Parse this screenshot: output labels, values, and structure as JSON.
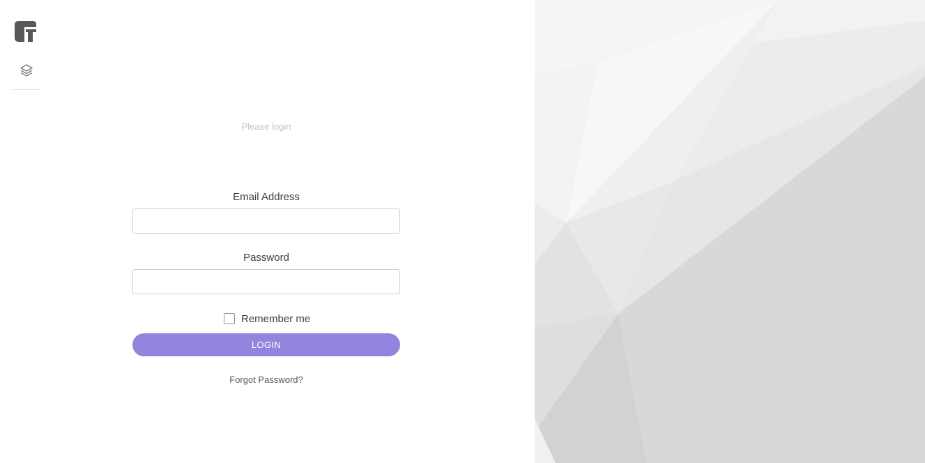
{
  "rail": {
    "logo_icon": "brand-logo-icon",
    "nav_icon": "layers-icon"
  },
  "login": {
    "subtitle": "Please login",
    "email_label": "Email Address",
    "email_value": "",
    "password_label": "Password",
    "password_value": "",
    "remember_label": "Remember me",
    "remember_checked": false,
    "button_label": "LOGIN",
    "forgot_label": "Forgot Password?"
  },
  "colors": {
    "accent": "#9484dd",
    "logo": "#585858",
    "background_art": "#d9d9d9"
  }
}
